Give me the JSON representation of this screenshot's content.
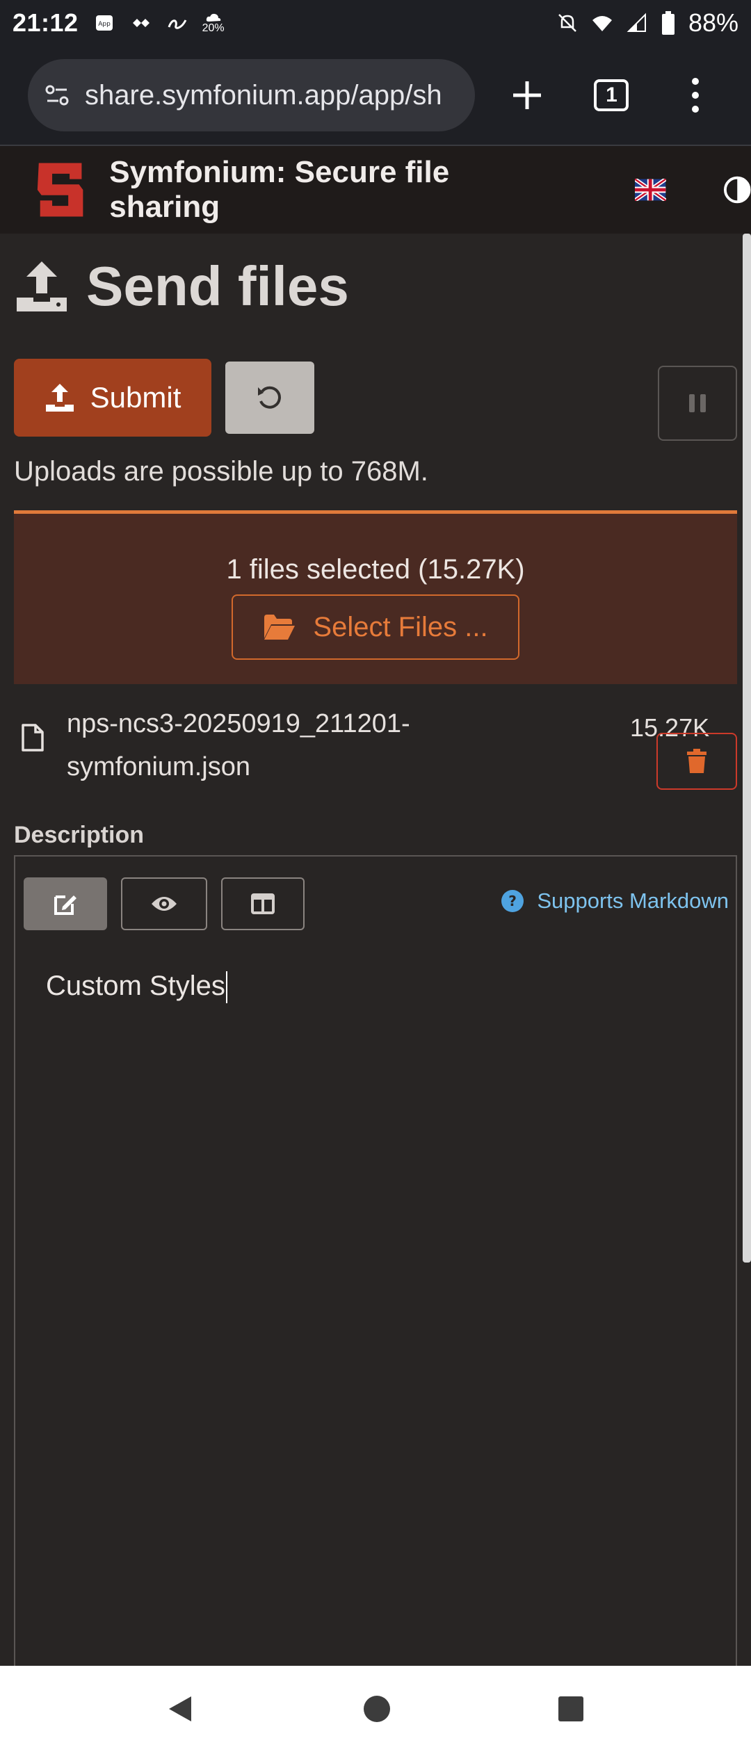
{
  "status_bar": {
    "time": "21:12",
    "weather_label": "20%",
    "battery": "88%"
  },
  "browser": {
    "url": "share.symfonium.app/app/sh",
    "tab_count": "1"
  },
  "app": {
    "title": "Symfonium: Secure file sharing"
  },
  "page": {
    "title": "Send files",
    "submit_label": "Submit",
    "upload_note": "Uploads are possible up to 768M."
  },
  "dropzone": {
    "count_label": "1 files selected (15.27K)",
    "select_label": "Select Files ..."
  },
  "files": [
    {
      "name": "nps-ncs3-20250919_211201-symfonium.json",
      "size": "15.27K"
    }
  ],
  "description": {
    "label": "Description",
    "markdown_hint": "Supports Markdown",
    "text": "Custom Styles"
  },
  "colors": {
    "accent": "#e07a3a",
    "submit": "#a1401e",
    "danger": "#cc3a2a",
    "link": "#7ec3ee"
  }
}
